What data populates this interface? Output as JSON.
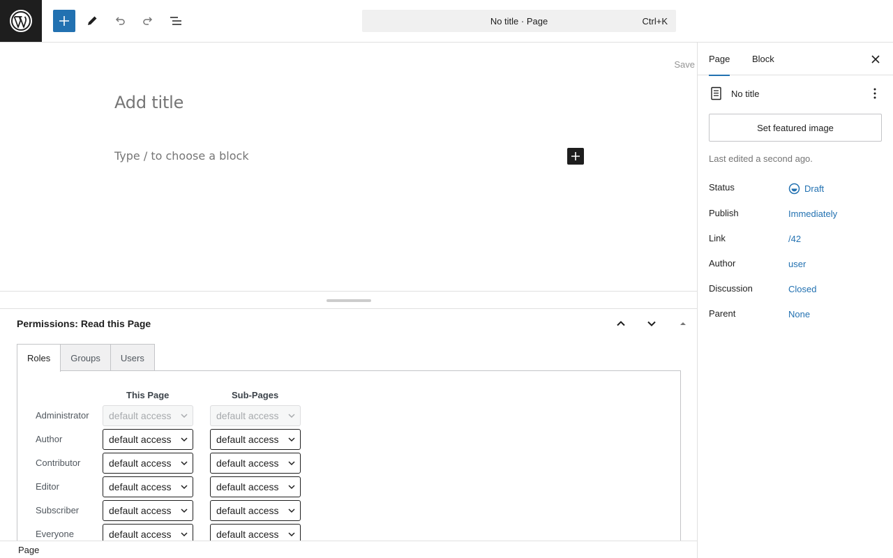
{
  "topbar": {
    "logo_icon": "wordpress-logo",
    "add_block_icon": "plus-icon",
    "tools_icon": "pencil-icon",
    "undo_icon": "undo-icon",
    "redo_icon": "redo-icon",
    "list_view_icon": "list-view-icon",
    "command_bar": {
      "text": "No title · Page",
      "shortcut": "Ctrl+K"
    }
  },
  "canvas": {
    "save_label": "Save",
    "title_placeholder": "Add title",
    "block_placeholder": "Type / to choose a block"
  },
  "metabox": {
    "title": "Permissions: Read this Page",
    "tabs": [
      "Roles",
      "Groups",
      "Users"
    ],
    "active_tab": "Roles",
    "column_headers": {
      "this_page": "This Page",
      "sub_pages": "Sub-Pages"
    },
    "rows": [
      {
        "role": "Administrator",
        "this_page": "default access",
        "sub_pages": "default access",
        "disabled": true
      },
      {
        "role": "Author",
        "this_page": "default access",
        "sub_pages": "default access",
        "disabled": false
      },
      {
        "role": "Contributor",
        "this_page": "default access",
        "sub_pages": "default access",
        "disabled": false
      },
      {
        "role": "Editor",
        "this_page": "default access",
        "sub_pages": "default access",
        "disabled": false
      },
      {
        "role": "Subscriber",
        "this_page": "default access",
        "sub_pages": "default access",
        "disabled": false
      },
      {
        "role": "Everyone",
        "this_page": "default access",
        "sub_pages": "default access",
        "disabled": false
      }
    ]
  },
  "footer": {
    "label": "Page"
  },
  "sidebar": {
    "tabs": [
      "Page",
      "Block"
    ],
    "active_tab": "Page",
    "doc_title": "No title",
    "featured_image_button": "Set featured image",
    "last_edited": "Last edited a second ago.",
    "properties": [
      {
        "key": "Status",
        "value": "Draft",
        "icon": "draft-status-icon"
      },
      {
        "key": "Publish",
        "value": "Immediately"
      },
      {
        "key": "Link",
        "value": "/42"
      },
      {
        "key": "Author",
        "value": "user"
      },
      {
        "key": "Discussion",
        "value": "Closed"
      },
      {
        "key": "Parent",
        "value": "None"
      }
    ]
  },
  "colors": {
    "accent": "#2271b1",
    "dark": "#1e1e1e",
    "border": "#e0e0e0"
  }
}
